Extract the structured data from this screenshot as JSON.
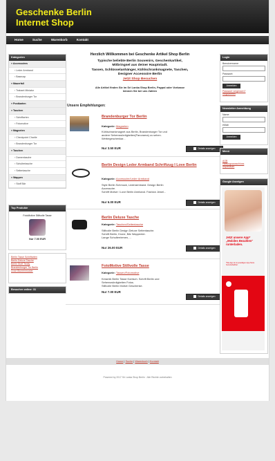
{
  "site": {
    "title_line1": "Geschenke Berlin",
    "title_line2": "Internet Shop"
  },
  "nav": [
    "Home",
    "Suche",
    "Warenkorb",
    "Kontakt"
  ],
  "sidebar": {
    "categories_title": "Kategorien",
    "categories": [
      {
        "label": "Accessoires",
        "type": "main"
      },
      {
        "label": "Leder Armband",
        "type": "sub"
      },
      {
        "label": "Basecap",
        "type": "sub"
      },
      {
        "label": "Mauerfall",
        "type": "main"
      },
      {
        "label": "Trabant Miniatur",
        "type": "sub"
      },
      {
        "label": "Brandenburger Tor",
        "type": "sub"
      },
      {
        "label": "Postkarten",
        "type": "main"
      },
      {
        "label": "Taschen",
        "type": "main"
      },
      {
        "label": "Schriftarten",
        "type": "sub"
      },
      {
        "label": "Fotomotive",
        "type": "sub"
      },
      {
        "label": "Magneten",
        "type": "main"
      },
      {
        "label": "Checkpoint Charlie",
        "type": "sub"
      },
      {
        "label": "Brandenburger Tor",
        "type": "sub"
      },
      {
        "label": "Taschen",
        "type": "main"
      },
      {
        "label": "Damentasche",
        "type": "sub"
      },
      {
        "label": "Schultertasche",
        "type": "sub"
      },
      {
        "label": "Seitentasche",
        "type": "sub"
      },
      {
        "label": "Wappen",
        "type": "main"
      },
      {
        "label": "Stoff Bär",
        "type": "sub"
      }
    ],
    "top_title": "Top Produkte",
    "top_product": {
      "name": "FotoMotive Stillvolle Tasse",
      "price": "Nur 7.00 EUR"
    },
    "top_links": [
      "Berlin Tasse Schriftarten",
      "Berlin Deluxe Tasche",
      "Berlin Stoff Teddy",
      "Brandenburger Tor Berlin",
      "Dose Blumenmuster"
    ],
    "online": "Besucher online: 31"
  },
  "welcome": {
    "title": "Herzlich Willkommen bei Geschenke Artikel Shop Berlin",
    "line1": "Typische beliebte Berlin Souvenirs, Geschenkartikel,",
    "line2": "Mitbringsel aus deiner Hauptstadt.",
    "line3": "Tassen, Schlüsselanhänger, Kühlschrankmagnete, Taschen,",
    "line4": "Designer Accessoire Berlin",
    "link": "Jetzt Shop Besuchen",
    "note1": "Alle Artikel finden Sie im Sri Lanka Shop Berlin, Paypal oder Vorkasse",
    "note2": "können Sie bei uns Zahlen"
  },
  "recommend_title": "Unsere Empfehlungen:",
  "products": [
    {
      "title": "Brandenburger Tor Berlin",
      "cat_label": "Kategorie:",
      "category": "Magneten",
      "desc": [
        "Kühlschrankmagnet aus Berlin, Brandenburger Tor und",
        "andere Sehenswürdigkeiten(Panorama) zu sehen.",
        "Werbegeschenkar..."
      ],
      "price": "Nur 3.50 EUR",
      "button": "Details anzeigen"
    },
    {
      "title": "Berlin Design Leder Armband Schriftzug I Love Berlin",
      "cat_label": "Kategorie:",
      "category": "Accessoire/Leder Armband",
      "desc": [
        "Style Berlin Schmuck, Lederarmband. Design Berlin",
        "Accessoire.",
        "Schrift Motive I Love Berlin Armband. Fashion Jewel..."
      ],
      "price": "Nur 6.00 EUR",
      "button": "Details anzeigen"
    },
    {
      "title": "Berlin Deluxe Tasche",
      "cat_label": "Kategorie:",
      "category": "Taschen/Seitentasche",
      "desc": [
        "Stillvolle Berlin Design Deluxe Seitentasche.",
        "Schrift Berlin, Krone, Bär Wappenter.",
        "Lange Schulterriemen, ..."
      ],
      "price": "Nur 26.00 EUR",
      "button": "Details anzeigen"
    },
    {
      "title": "FotoMotive Stillvolle Tasse",
      "cat_label": "Kategorie:",
      "category": "Tassen/Fotomotive",
      "desc": [
        "Keramik Berlin Tasse Kontsch. Schrift Berlin und",
        "Sehenswürdigkeiten Fotos.",
        "Stillvolle Berlin Motive Geschenke."
      ],
      "price": "Nur 7.00 EUR",
      "button": "Details anzeigen"
    }
  ],
  "right": {
    "login_title": "Login",
    "user_label": "Benutzername:",
    "pass_label": "Passwort:",
    "login_btn": "Anmelden",
    "forgot": "Passwort vergessen?",
    "register": "Registrieren",
    "news_title": "Newsletter Anmeldung",
    "name_label": "Name:",
    "email_label": "eMail:",
    "news_btn": "Anmelden",
    "menu_title": "Menü",
    "menu_items": [
      "AGB",
      "Haftungsausschluss",
      "Impressum"
    ],
    "ads_title": "Google Anzeigen",
    "ad_text1": "Jetzt unsere App* „Mobiles Bezahlen“ runterladen.",
    "ad_text2": "*Die App ist im jeweiligen App-Store herunterladbar."
  },
  "footer": {
    "links": [
      "Home",
      "Suche",
      "Warenkorb",
      "Kontakt"
    ],
    "copyright": "Powered by 2017 Sri Lanka Shop Berlin · Alle Rechte vorbehalten"
  },
  "colors": {
    "accent": "#c0392b",
    "title_yellow": "#f2ea1c",
    "header_dark": "#1e1e1e"
  }
}
